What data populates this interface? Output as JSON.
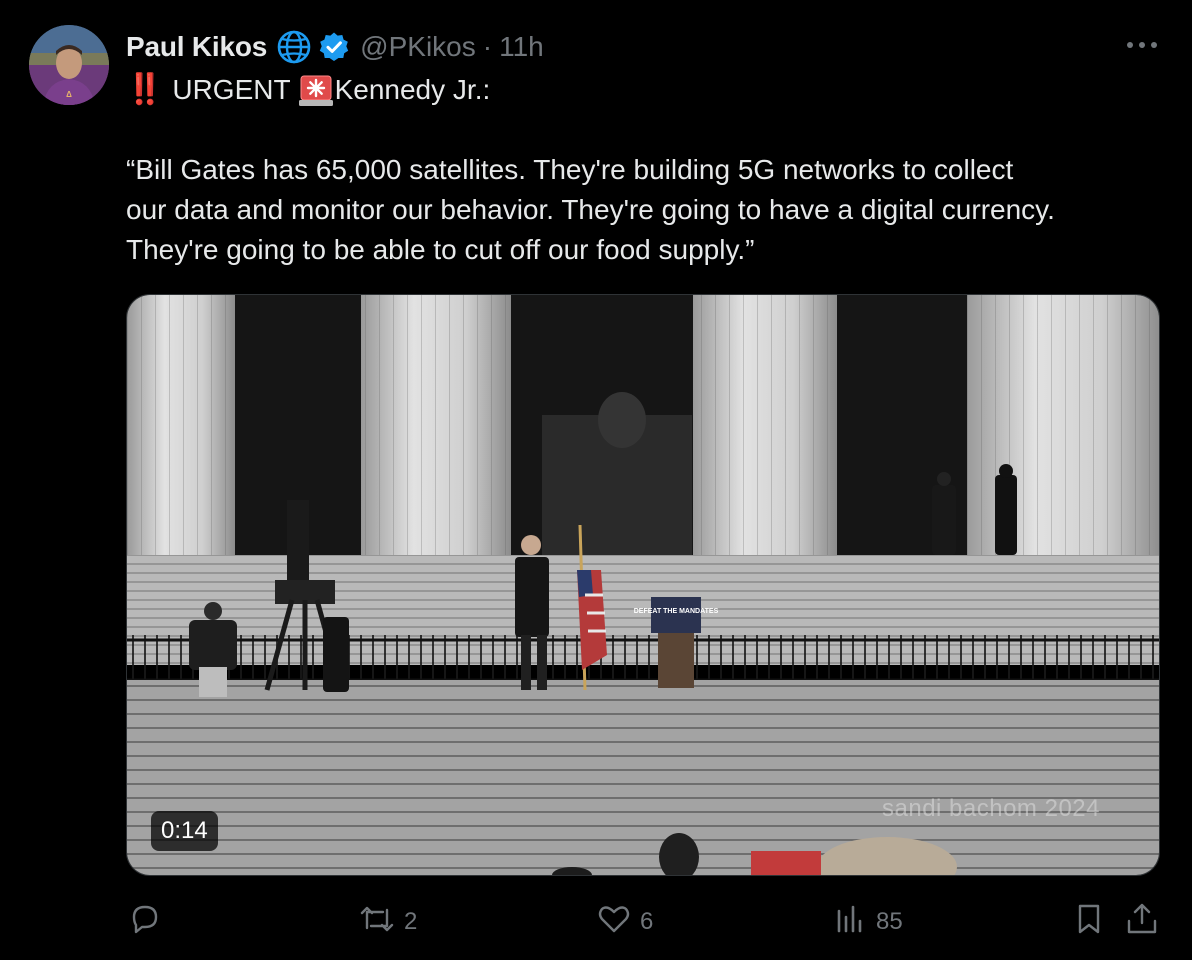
{
  "author": {
    "name": "Paul Kikos",
    "handle": "@PKikos",
    "separator": "·",
    "time": "11h"
  },
  "icons": {
    "avatar": "profile-photo",
    "globe": "globe-icon",
    "verified": "verified-badge-icon",
    "more": "more-horizontal-icon",
    "siren": "rotating-light-emoji",
    "reply": "reply-icon",
    "repost": "repost-icon",
    "like": "heart-icon",
    "views": "views-chart-icon",
    "bookmark": "bookmark-icon",
    "share": "share-icon"
  },
  "tweet": {
    "emphasis": "‼️",
    "urgent": "URGENT",
    "subject": "Kennedy Jr.:",
    "quote": "“Bill Gates has 65,000 satellites. They're building 5G networks to collect\nour data and monitor our behavior. They're going to have a digital currency.\nThey're going to be able to cut off our food supply.”"
  },
  "video": {
    "duration": "0:14",
    "watermark": "sandi bachom 2024",
    "sign_text": "DEFEAT THE MANDATES"
  },
  "actions": {
    "reply_count": "",
    "repost_count": "2",
    "like_count": "6",
    "view_count": "85"
  },
  "colors": {
    "background": "#000000",
    "text": "#e7e9ea",
    "secondary": "#71767b",
    "verified": "#1d9bf0",
    "urgent": "#e0245e"
  }
}
